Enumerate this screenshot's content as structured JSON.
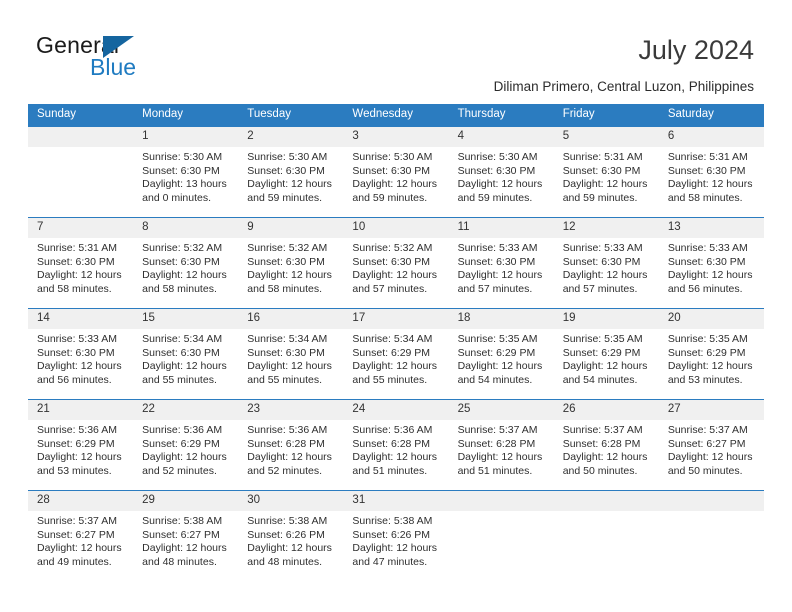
{
  "brand": {
    "name_top": "General",
    "name_bottom": "Blue",
    "color_dark": "#1a1a1a",
    "color_blue": "#1f7bc1",
    "triangle_color": "#15659f"
  },
  "header": {
    "title": "July 2024",
    "subtitle": "Diliman Primero, Central Luzon, Philippines"
  },
  "theme": {
    "header_bg": "#2b7cc0",
    "header_text": "#ffffff",
    "daynum_bg": "#f0f0f0",
    "row_divider": "#2b7cc0",
    "body_text": "#2f2f2f"
  },
  "weekdays": [
    "Sunday",
    "Monday",
    "Tuesday",
    "Wednesday",
    "Thursday",
    "Friday",
    "Saturday"
  ],
  "labels": {
    "sunrise_prefix": "Sunrise:",
    "sunset_prefix": "Sunset:",
    "daylight_prefix": "Daylight:"
  },
  "weeks": [
    [
      {
        "day": "",
        "empty": true,
        "l1": "",
        "l2": "",
        "l3": "",
        "l4": ""
      },
      {
        "day": "1",
        "l1": "Sunrise: 5:30 AM",
        "l2": "Sunset: 6:30 PM",
        "l3": "Daylight: 13 hours",
        "l4": "and 0 minutes."
      },
      {
        "day": "2",
        "l1": "Sunrise: 5:30 AM",
        "l2": "Sunset: 6:30 PM",
        "l3": "Daylight: 12 hours",
        "l4": "and 59 minutes."
      },
      {
        "day": "3",
        "l1": "Sunrise: 5:30 AM",
        "l2": "Sunset: 6:30 PM",
        "l3": "Daylight: 12 hours",
        "l4": "and 59 minutes."
      },
      {
        "day": "4",
        "l1": "Sunrise: 5:30 AM",
        "l2": "Sunset: 6:30 PM",
        "l3": "Daylight: 12 hours",
        "l4": "and 59 minutes."
      },
      {
        "day": "5",
        "l1": "Sunrise: 5:31 AM",
        "l2": "Sunset: 6:30 PM",
        "l3": "Daylight: 12 hours",
        "l4": "and 59 minutes."
      },
      {
        "day": "6",
        "l1": "Sunrise: 5:31 AM",
        "l2": "Sunset: 6:30 PM",
        "l3": "Daylight: 12 hours",
        "l4": "and 58 minutes."
      }
    ],
    [
      {
        "day": "7",
        "l1": "Sunrise: 5:31 AM",
        "l2": "Sunset: 6:30 PM",
        "l3": "Daylight: 12 hours",
        "l4": "and 58 minutes."
      },
      {
        "day": "8",
        "l1": "Sunrise: 5:32 AM",
        "l2": "Sunset: 6:30 PM",
        "l3": "Daylight: 12 hours",
        "l4": "and 58 minutes."
      },
      {
        "day": "9",
        "l1": "Sunrise: 5:32 AM",
        "l2": "Sunset: 6:30 PM",
        "l3": "Daylight: 12 hours",
        "l4": "and 58 minutes."
      },
      {
        "day": "10",
        "l1": "Sunrise: 5:32 AM",
        "l2": "Sunset: 6:30 PM",
        "l3": "Daylight: 12 hours",
        "l4": "and 57 minutes."
      },
      {
        "day": "11",
        "l1": "Sunrise: 5:33 AM",
        "l2": "Sunset: 6:30 PM",
        "l3": "Daylight: 12 hours",
        "l4": "and 57 minutes."
      },
      {
        "day": "12",
        "l1": "Sunrise: 5:33 AM",
        "l2": "Sunset: 6:30 PM",
        "l3": "Daylight: 12 hours",
        "l4": "and 57 minutes."
      },
      {
        "day": "13",
        "l1": "Sunrise: 5:33 AM",
        "l2": "Sunset: 6:30 PM",
        "l3": "Daylight: 12 hours",
        "l4": "and 56 minutes."
      }
    ],
    [
      {
        "day": "14",
        "l1": "Sunrise: 5:33 AM",
        "l2": "Sunset: 6:30 PM",
        "l3": "Daylight: 12 hours",
        "l4": "and 56 minutes."
      },
      {
        "day": "15",
        "l1": "Sunrise: 5:34 AM",
        "l2": "Sunset: 6:30 PM",
        "l3": "Daylight: 12 hours",
        "l4": "and 55 minutes."
      },
      {
        "day": "16",
        "l1": "Sunrise: 5:34 AM",
        "l2": "Sunset: 6:30 PM",
        "l3": "Daylight: 12 hours",
        "l4": "and 55 minutes."
      },
      {
        "day": "17",
        "l1": "Sunrise: 5:34 AM",
        "l2": "Sunset: 6:29 PM",
        "l3": "Daylight: 12 hours",
        "l4": "and 55 minutes."
      },
      {
        "day": "18",
        "l1": "Sunrise: 5:35 AM",
        "l2": "Sunset: 6:29 PM",
        "l3": "Daylight: 12 hours",
        "l4": "and 54 minutes."
      },
      {
        "day": "19",
        "l1": "Sunrise: 5:35 AM",
        "l2": "Sunset: 6:29 PM",
        "l3": "Daylight: 12 hours",
        "l4": "and 54 minutes."
      },
      {
        "day": "20",
        "l1": "Sunrise: 5:35 AM",
        "l2": "Sunset: 6:29 PM",
        "l3": "Daylight: 12 hours",
        "l4": "and 53 minutes."
      }
    ],
    [
      {
        "day": "21",
        "l1": "Sunrise: 5:36 AM",
        "l2": "Sunset: 6:29 PM",
        "l3": "Daylight: 12 hours",
        "l4": "and 53 minutes."
      },
      {
        "day": "22",
        "l1": "Sunrise: 5:36 AM",
        "l2": "Sunset: 6:29 PM",
        "l3": "Daylight: 12 hours",
        "l4": "and 52 minutes."
      },
      {
        "day": "23",
        "l1": "Sunrise: 5:36 AM",
        "l2": "Sunset: 6:28 PM",
        "l3": "Daylight: 12 hours",
        "l4": "and 52 minutes."
      },
      {
        "day": "24",
        "l1": "Sunrise: 5:36 AM",
        "l2": "Sunset: 6:28 PM",
        "l3": "Daylight: 12 hours",
        "l4": "and 51 minutes."
      },
      {
        "day": "25",
        "l1": "Sunrise: 5:37 AM",
        "l2": "Sunset: 6:28 PM",
        "l3": "Daylight: 12 hours",
        "l4": "and 51 minutes."
      },
      {
        "day": "26",
        "l1": "Sunrise: 5:37 AM",
        "l2": "Sunset: 6:28 PM",
        "l3": "Daylight: 12 hours",
        "l4": "and 50 minutes."
      },
      {
        "day": "27",
        "l1": "Sunrise: 5:37 AM",
        "l2": "Sunset: 6:27 PM",
        "l3": "Daylight: 12 hours",
        "l4": "and 50 minutes."
      }
    ],
    [
      {
        "day": "28",
        "l1": "Sunrise: 5:37 AM",
        "l2": "Sunset: 6:27 PM",
        "l3": "Daylight: 12 hours",
        "l4": "and 49 minutes."
      },
      {
        "day": "29",
        "l1": "Sunrise: 5:38 AM",
        "l2": "Sunset: 6:27 PM",
        "l3": "Daylight: 12 hours",
        "l4": "and 48 minutes."
      },
      {
        "day": "30",
        "l1": "Sunrise: 5:38 AM",
        "l2": "Sunset: 6:26 PM",
        "l3": "Daylight: 12 hours",
        "l4": "and 48 minutes."
      },
      {
        "day": "31",
        "l1": "Sunrise: 5:38 AM",
        "l2": "Sunset: 6:26 PM",
        "l3": "Daylight: 12 hours",
        "l4": "and 47 minutes."
      },
      {
        "day": "",
        "empty": true,
        "l1": "",
        "l2": "",
        "l3": "",
        "l4": ""
      },
      {
        "day": "",
        "empty": true,
        "l1": "",
        "l2": "",
        "l3": "",
        "l4": ""
      },
      {
        "day": "",
        "empty": true,
        "l1": "",
        "l2": "",
        "l3": "",
        "l4": ""
      }
    ]
  ]
}
